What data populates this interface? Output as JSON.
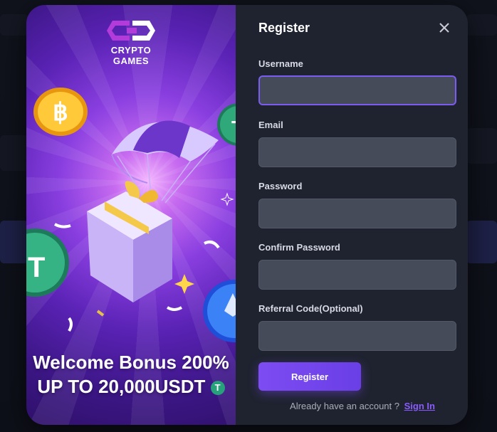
{
  "brand": {
    "line1": "CRYPTO",
    "line2": "GAMES"
  },
  "promo": {
    "headline_line1": "Welcome Bonus 200%",
    "headline_line2": "UP TO 20,000USDT",
    "coin_symbol": "T"
  },
  "form": {
    "title": "Register",
    "fields": [
      {
        "label": "Username",
        "value": ""
      },
      {
        "label": "Email",
        "value": ""
      },
      {
        "label": "Password",
        "value": ""
      },
      {
        "label": "Confirm Password",
        "value": ""
      },
      {
        "label": "Referral Code(Optional)",
        "value": ""
      }
    ],
    "submit_label": "Register",
    "signin_prompt": "Already have an account ?",
    "signin_link": "Sign In"
  },
  "icons": {
    "close": "close-icon",
    "logo": "crypto-games-logo-icon"
  },
  "colors": {
    "accent": "#7d4cf2",
    "panel": "#1f232f",
    "input": "#464b59",
    "promo_purple": "#5a22b5"
  }
}
